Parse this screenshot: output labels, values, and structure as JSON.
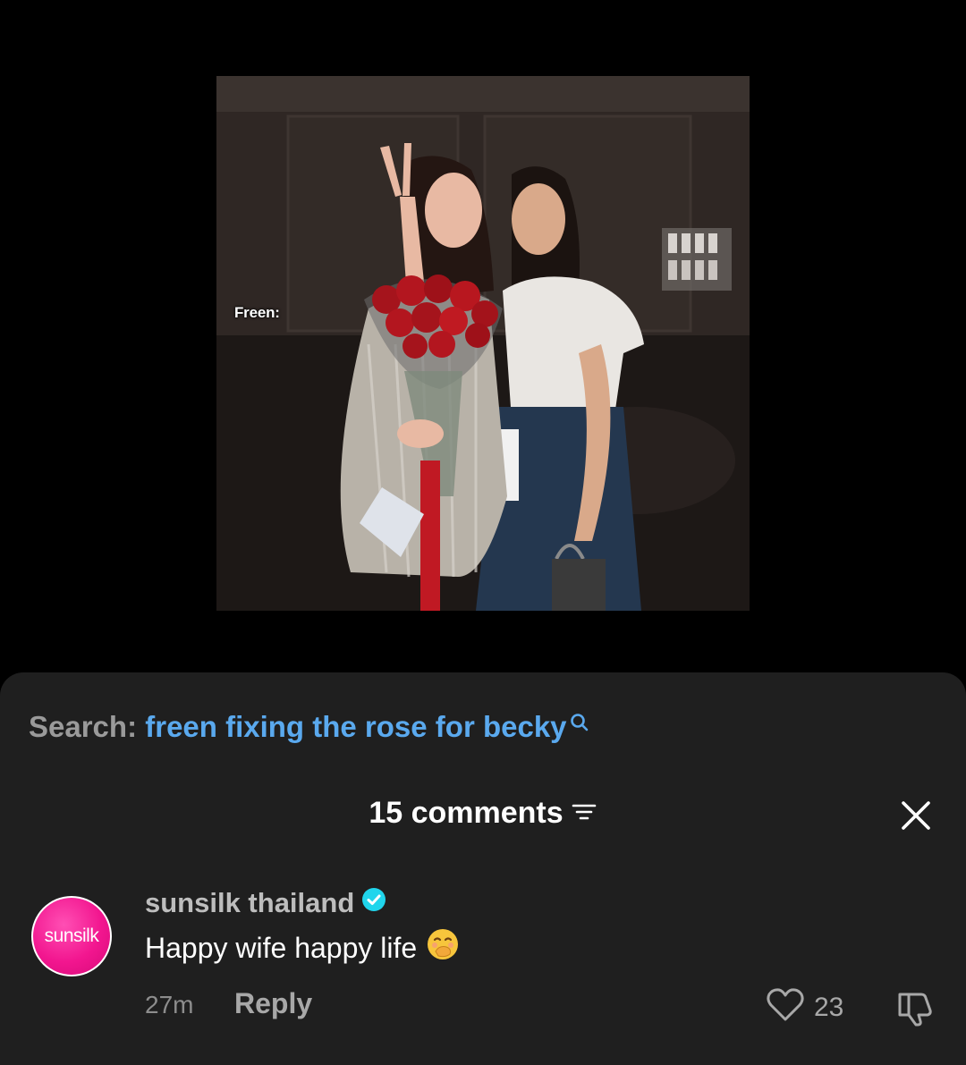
{
  "photo": {
    "caption": "Freen:"
  },
  "search": {
    "prefix": "Search: ",
    "query": "freen fixing the rose for becky",
    "icon": "search-icon"
  },
  "comments": {
    "header": "15 comments",
    "filter_icon": "filter-icon",
    "close_icon": "close-icon"
  },
  "comment": {
    "avatar_text": "sunsilk",
    "username": "sunsilk thailand",
    "verified_icon": "verified-badge-icon",
    "text": "Happy wife happy life",
    "emoji": "face-with-hand-over-mouth",
    "time": "27m",
    "reply_label": "Reply",
    "like_count": "23",
    "like_icon": "heart-icon",
    "dislike_icon": "thumbs-down-icon"
  },
  "colors": {
    "sheet_bg": "#1f1f1f",
    "query": "#5aa9ee",
    "avatar_pink": "#f2168f",
    "verified": "#20d5ec"
  }
}
